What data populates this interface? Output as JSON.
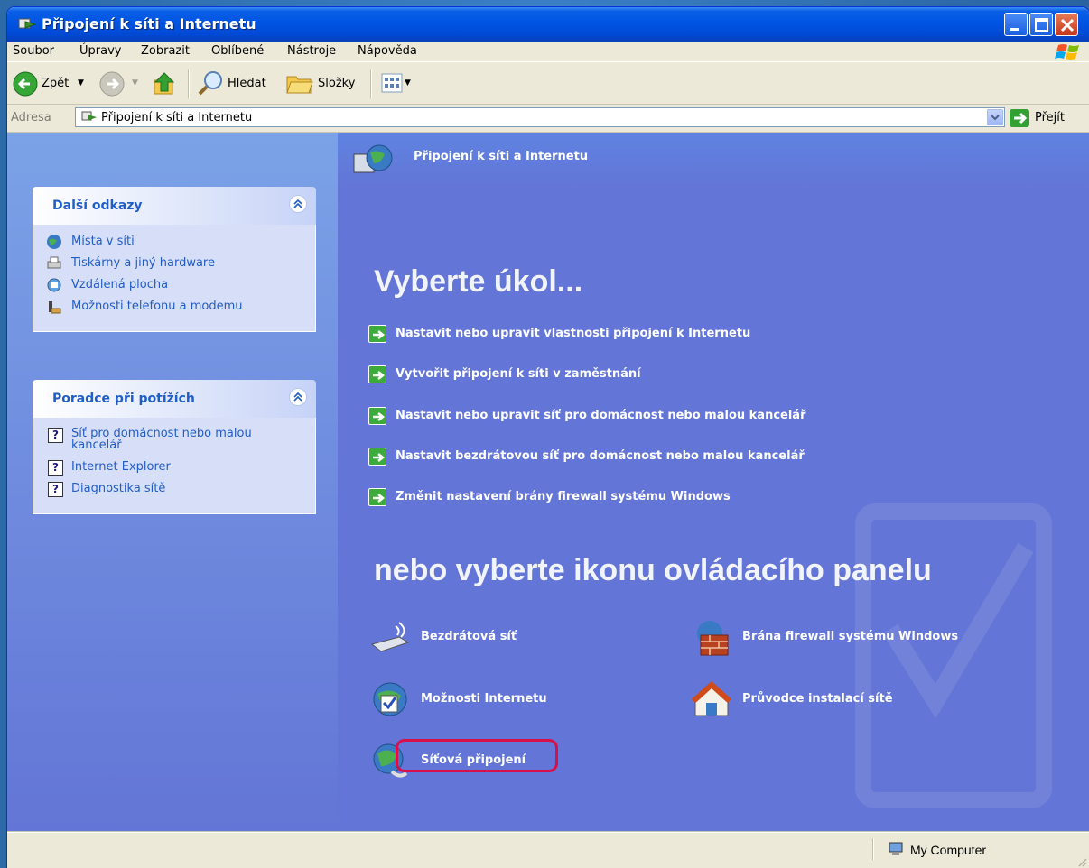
{
  "window": {
    "title": "Připojení k síti a Internetu"
  },
  "menu": [
    "Soubor",
    "Úpravy",
    "Zobrazit",
    "Oblíbené",
    "Nástroje",
    "Nápověda"
  ],
  "toolbar": {
    "back_label": "Zpět",
    "search_label": "Hledat",
    "folders_label": "Složky"
  },
  "address": {
    "label": "Adresa",
    "value": "Připojení k síti a Internetu",
    "go_label": "Přejít"
  },
  "sidebar": {
    "other_links": {
      "title": "Další odkazy",
      "items": [
        "Místa v síti",
        "Tiskárny a jiný hardware",
        "Vzdálená plocha",
        "Možnosti telefonu a modemu"
      ]
    },
    "troubleshooters": {
      "title": "Poradce při potížích",
      "items": [
        "Síť pro domácnost nebo malou kancelář",
        "Internet Explorer",
        "Diagnostika sítě"
      ]
    }
  },
  "main": {
    "header_title": "Připojení k síti a Internetu",
    "pick_task": "Vyberte úkol...",
    "tasks": [
      "Nastavit nebo upravit vlastnosti připojení k Internetu",
      "Vytvořit připojení k síti v zaměstnání",
      "Nastavit nebo upravit síť pro domácnost nebo malou kancelář",
      "Nastavit bezdrátovou síť pro domácnost nebo malou kancelář",
      "Změnit nastavení brány firewall systému Windows"
    ],
    "pick_icon": "nebo vyberte ikonu ovládacího panelu",
    "icons": {
      "wireless": "Bezdrátová síť",
      "firewall": "Brána firewall systému Windows",
      "internet_options": "Možnosti Internetu",
      "network_setup": "Průvodce instalací sítě",
      "network_connections": "Síťová připojení"
    }
  },
  "status": {
    "zone": "My Computer"
  },
  "colors": {
    "title_bar": "#0054e3",
    "main_background": "#6375d6",
    "task_arrow": "#3cab3c",
    "highlight": "#d6114a"
  }
}
